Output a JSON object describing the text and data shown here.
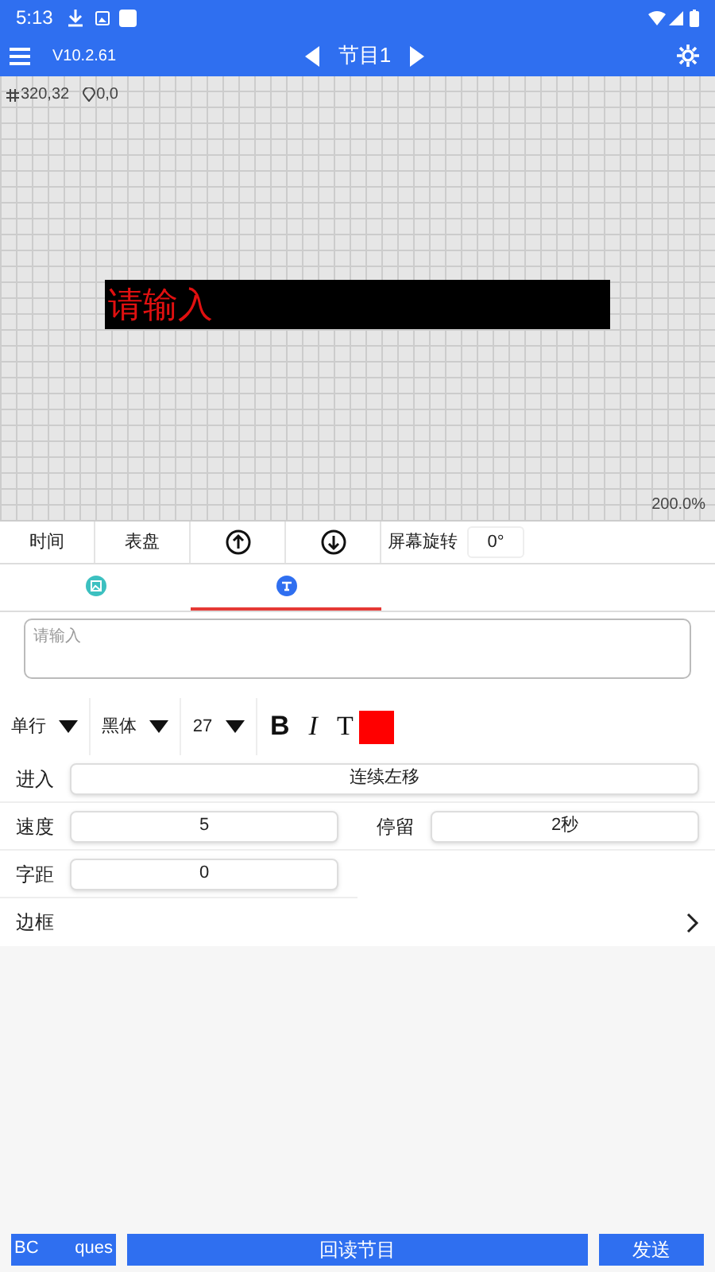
{
  "status_bar": {
    "time": "5:13"
  },
  "app_bar": {
    "version": "V10.2.61",
    "program": "节目1"
  },
  "canvas": {
    "size": "320,32",
    "origin": "0,0",
    "preview_text": "请输入",
    "zoom": "200.0%"
  },
  "toolbar": {
    "items": [
      {
        "kind": "text",
        "label": "时间"
      },
      {
        "kind": "text",
        "label": "表盘"
      },
      {
        "kind": "up"
      },
      {
        "kind": "down"
      }
    ],
    "rotate_label": "屏幕旋转",
    "rotate_value": "0°"
  },
  "tabs": [
    {
      "kind": "image",
      "selected": false
    },
    {
      "kind": "text",
      "selected": true
    }
  ],
  "text_input": {
    "placeholder": "请输入"
  },
  "format": {
    "line_mode": "单行",
    "font": "黑体",
    "size": "27",
    "bold_label": "B",
    "italic_label": "I",
    "color_label": "T",
    "color": "#ff0000"
  },
  "settings": [
    {
      "kind": "full",
      "label": "进入",
      "value": "连续左移"
    },
    {
      "kind": "pair",
      "label": "速度",
      "value": "5",
      "label2": "停留",
      "value2": "2秒"
    },
    {
      "kind": "half",
      "label": "字距",
      "value": "0"
    }
  ],
  "border": {
    "label": "边框"
  },
  "bottom_buttons": {
    "left": [
      "BC",
      "ques"
    ],
    "readback": "回读节目",
    "send": "发送"
  }
}
